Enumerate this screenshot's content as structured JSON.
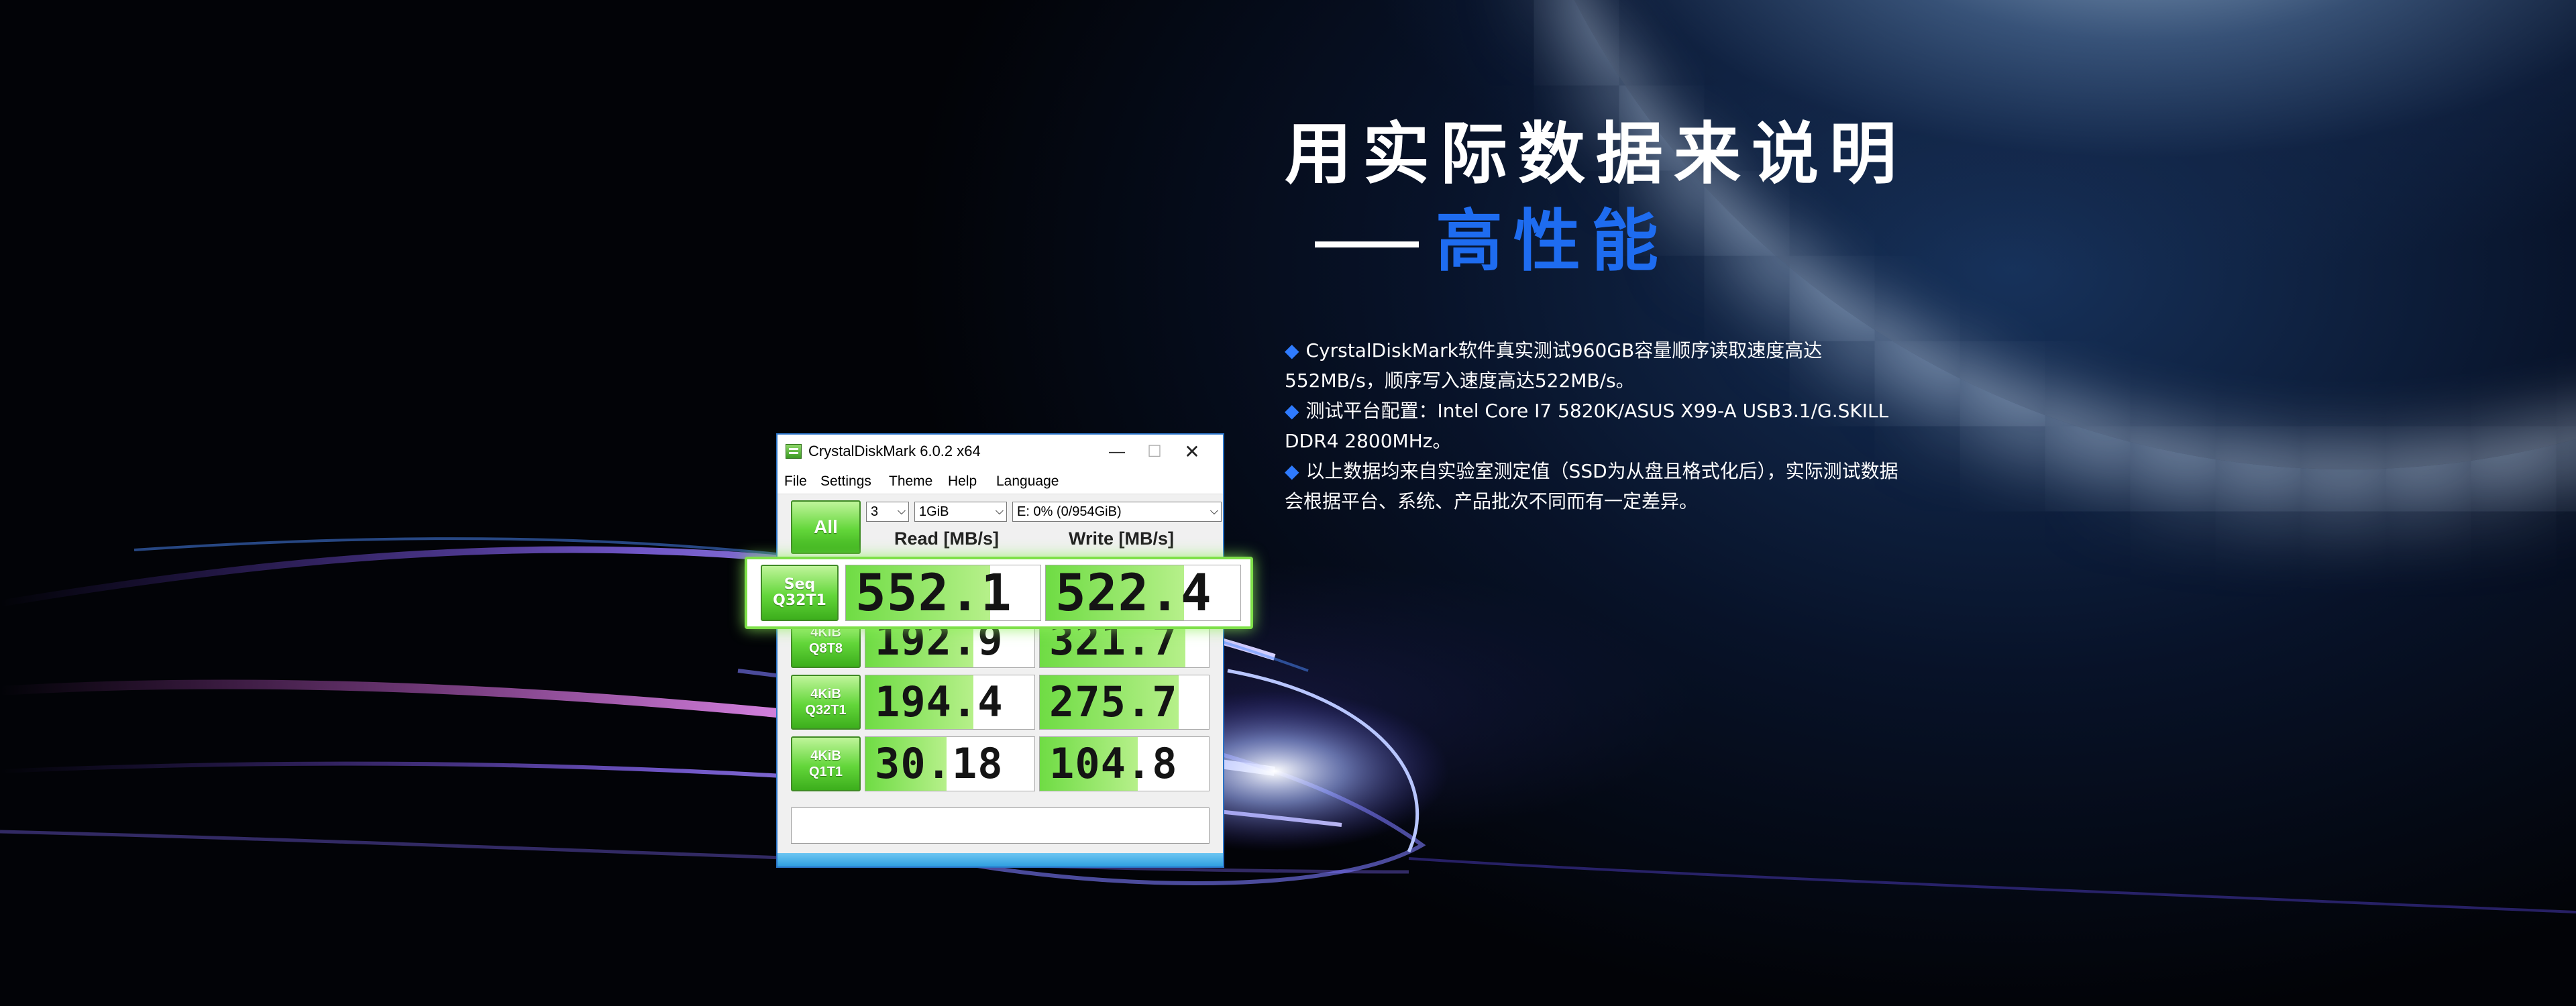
{
  "headline": {
    "line1": "用实际数据来说明",
    "line2": "高性能"
  },
  "bullets": [
    "CyrstalDiskMark软件真实测试960GB容量顺序读取速度高达552MB/s，顺序写入速度高达522MB/s。",
    "测试平台配置：Intel Core I7 5820K/ASUS X99-A USB3.1/G.SKILL DDR4 2800MHz。",
    "以上数据均来自实验室测定值（SSD为从盘且格式化后），实际测试数据会根据平台、系统、产品批次不同而有一定差异。"
  ],
  "bullet_marker": "◆",
  "colors": {
    "accent_blue": "#1e6cf0",
    "bar_green": "#6fdc44",
    "button_green": "#4cc22a",
    "window_border": "#2a73c7"
  },
  "window": {
    "title": "CrystalDiskMark 6.0.2 x64",
    "controls": {
      "minimize": "—",
      "maximize": "☐",
      "close": "✕"
    },
    "menu": [
      "File",
      "Settings",
      "Theme",
      "Help",
      "Language"
    ],
    "all_button": "All",
    "count_select": "3",
    "size_select": "1GiB",
    "drive_select": "E: 0% (0/954GiB)",
    "read_header": "Read [MB/s]",
    "write_header": "Write [MB/s]",
    "rows": [
      {
        "label_top": "Seq",
        "label_bottom": "Q32T1",
        "read": "552.1",
        "write": "522.4",
        "read_fill": 0.74,
        "write_fill": 0.71
      },
      {
        "label_top": "4KiB",
        "label_bottom": "Q8T8",
        "read": "192.9",
        "write": "321.7",
        "read_fill": 0.64,
        "write_fill": 0.86
      },
      {
        "label_top": "4KiB",
        "label_bottom": "Q32T1",
        "read": "194.4",
        "write": "275.7",
        "read_fill": 0.64,
        "write_fill": 0.82
      },
      {
        "label_top": "4KiB",
        "label_bottom": "Q1T1",
        "read": "30.18",
        "write": "104.8",
        "read_fill": 0.48,
        "write_fill": 0.58
      }
    ],
    "comment": ""
  },
  "icons": {
    "bullet": "diamond-bullet-icon",
    "app": "crystaldiskmark-app-icon",
    "dropdown": "chevron-down-icon"
  }
}
